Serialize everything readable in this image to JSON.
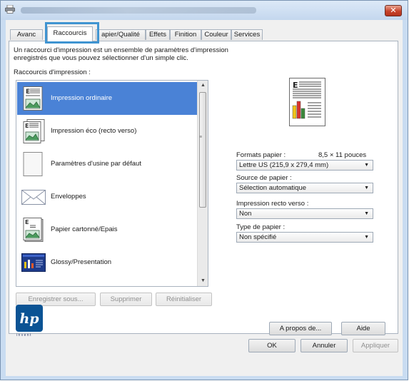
{
  "window": {
    "close_glyph": "✕"
  },
  "tabs": [
    {
      "label": "Avanc"
    },
    {
      "label": "Raccourcis",
      "active": true
    },
    {
      "label": "apier/Qualité"
    },
    {
      "label": "Effets"
    },
    {
      "label": "Finition"
    },
    {
      "label": "Couleur"
    },
    {
      "label": "Services"
    }
  ],
  "shortcuts": {
    "intro": "Un raccourci d'impression est un ensemble de paramètres d'impression\nenregistrés que vous pouvez sélectionner d'un simple clic.",
    "list_label": "Raccourcis d'impression :",
    "items": [
      {
        "label": "Impression ordinaire",
        "icon": "plain-print-icon",
        "selected": true
      },
      {
        "label": "Impression éco (recto verso)",
        "icon": "eco-duplex-icon"
      },
      {
        "label": "Paramètres d'usine par défaut",
        "icon": "factory-defaults-icon"
      },
      {
        "label": "Enveloppes",
        "icon": "envelope-icon"
      },
      {
        "label": "Papier cartonné/Epais",
        "icon": "cardstock-icon"
      },
      {
        "label": "Glossy/Presentation",
        "icon": "glossy-presentation-icon"
      }
    ],
    "buttons": {
      "save_as": "Enregistrer sous...",
      "delete": "Supprimer",
      "reset": "Réinitialiser"
    }
  },
  "settings": {
    "paper_format": {
      "label": "Formats papier :",
      "value": "8,5 × 11 pouces",
      "selected": "Lettre US (215,9 x 279,4 mm)"
    },
    "paper_source": {
      "label": "Source de papier :",
      "selected": "Sélection automatique"
    },
    "duplex": {
      "label": "Impression recto verso :",
      "selected": "Non"
    },
    "paper_type": {
      "label": "Type de papier :",
      "selected": "Non spécifié"
    }
  },
  "footer": {
    "brand_mark": "hp",
    "brand_tagline": "invent",
    "about_label": "A propos de...",
    "help_label": "Aide",
    "ok_label": "OK",
    "cancel_label": "Annuler",
    "apply_label": "Appliquer"
  },
  "colors": {
    "selection": "#4a82d6",
    "focus_ring": "#3f94d1",
    "hp_blue": "#0b5394"
  }
}
